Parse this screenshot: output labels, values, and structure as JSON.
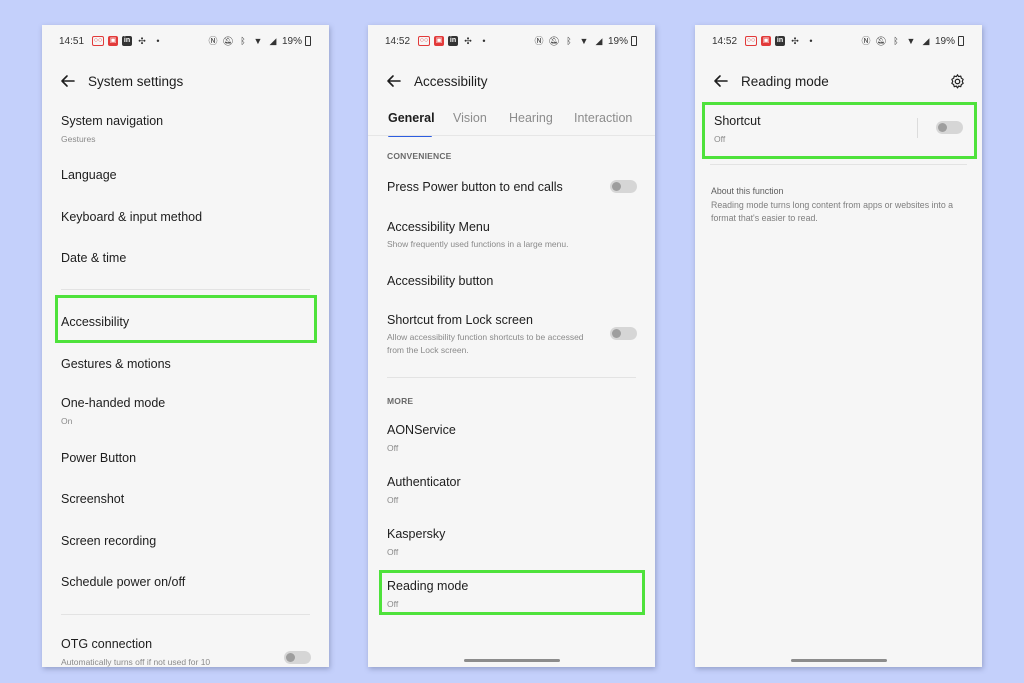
{
  "phone1": {
    "status": {
      "time": "14:51",
      "battery": "19%"
    },
    "title": "System settings",
    "items": [
      {
        "title": "System navigation",
        "sub": "Gestures"
      },
      {
        "title": "Language"
      },
      {
        "title": "Keyboard & input method"
      },
      {
        "title": "Date & time"
      },
      {
        "title": "Accessibility"
      },
      {
        "title": "Gestures & motions"
      },
      {
        "title": "One-handed mode",
        "sub": "On"
      },
      {
        "title": "Power Button"
      },
      {
        "title": "Screenshot"
      },
      {
        "title": "Screen recording"
      },
      {
        "title": "Schedule power on/off"
      },
      {
        "title": "OTG connection",
        "sub": "Automatically turns off if not used for 10"
      }
    ]
  },
  "phone2": {
    "status": {
      "time": "14:52",
      "battery": "19%"
    },
    "title": "Accessibility",
    "tabs": [
      "General",
      "Vision",
      "Hearing",
      "Interaction"
    ],
    "section_convenience": "CONVENIENCE",
    "section_more": "MORE",
    "items": [
      {
        "title": "Press Power button to end calls"
      },
      {
        "title": "Accessibility Menu",
        "sub": "Show frequently used functions in a large menu."
      },
      {
        "title": "Accessibility button"
      },
      {
        "title": "Shortcut from Lock screen",
        "sub": "Allow accessibility function shortcuts to be accessed from the Lock screen."
      },
      {
        "title": "AONService",
        "sub": "Off"
      },
      {
        "title": "Authenticator",
        "sub": "Off"
      },
      {
        "title": "Kaspersky",
        "sub": "Off"
      },
      {
        "title": "Reading mode",
        "sub": "Off"
      }
    ]
  },
  "phone3": {
    "status": {
      "time": "14:52",
      "battery": "19%"
    },
    "title": "Reading mode",
    "shortcut": {
      "title": "Shortcut",
      "sub": "Off"
    },
    "about": {
      "heading": "About this function",
      "body": "Reading mode turns long content from apps or websites into a format that's easier to read."
    }
  },
  "icons": {
    "back": "back-arrow-icon",
    "settings": "gear-icon"
  },
  "colors": {
    "background": "#c4d0fb",
    "highlight": "#4ee23b",
    "tab_accent": "#2d5de0"
  }
}
